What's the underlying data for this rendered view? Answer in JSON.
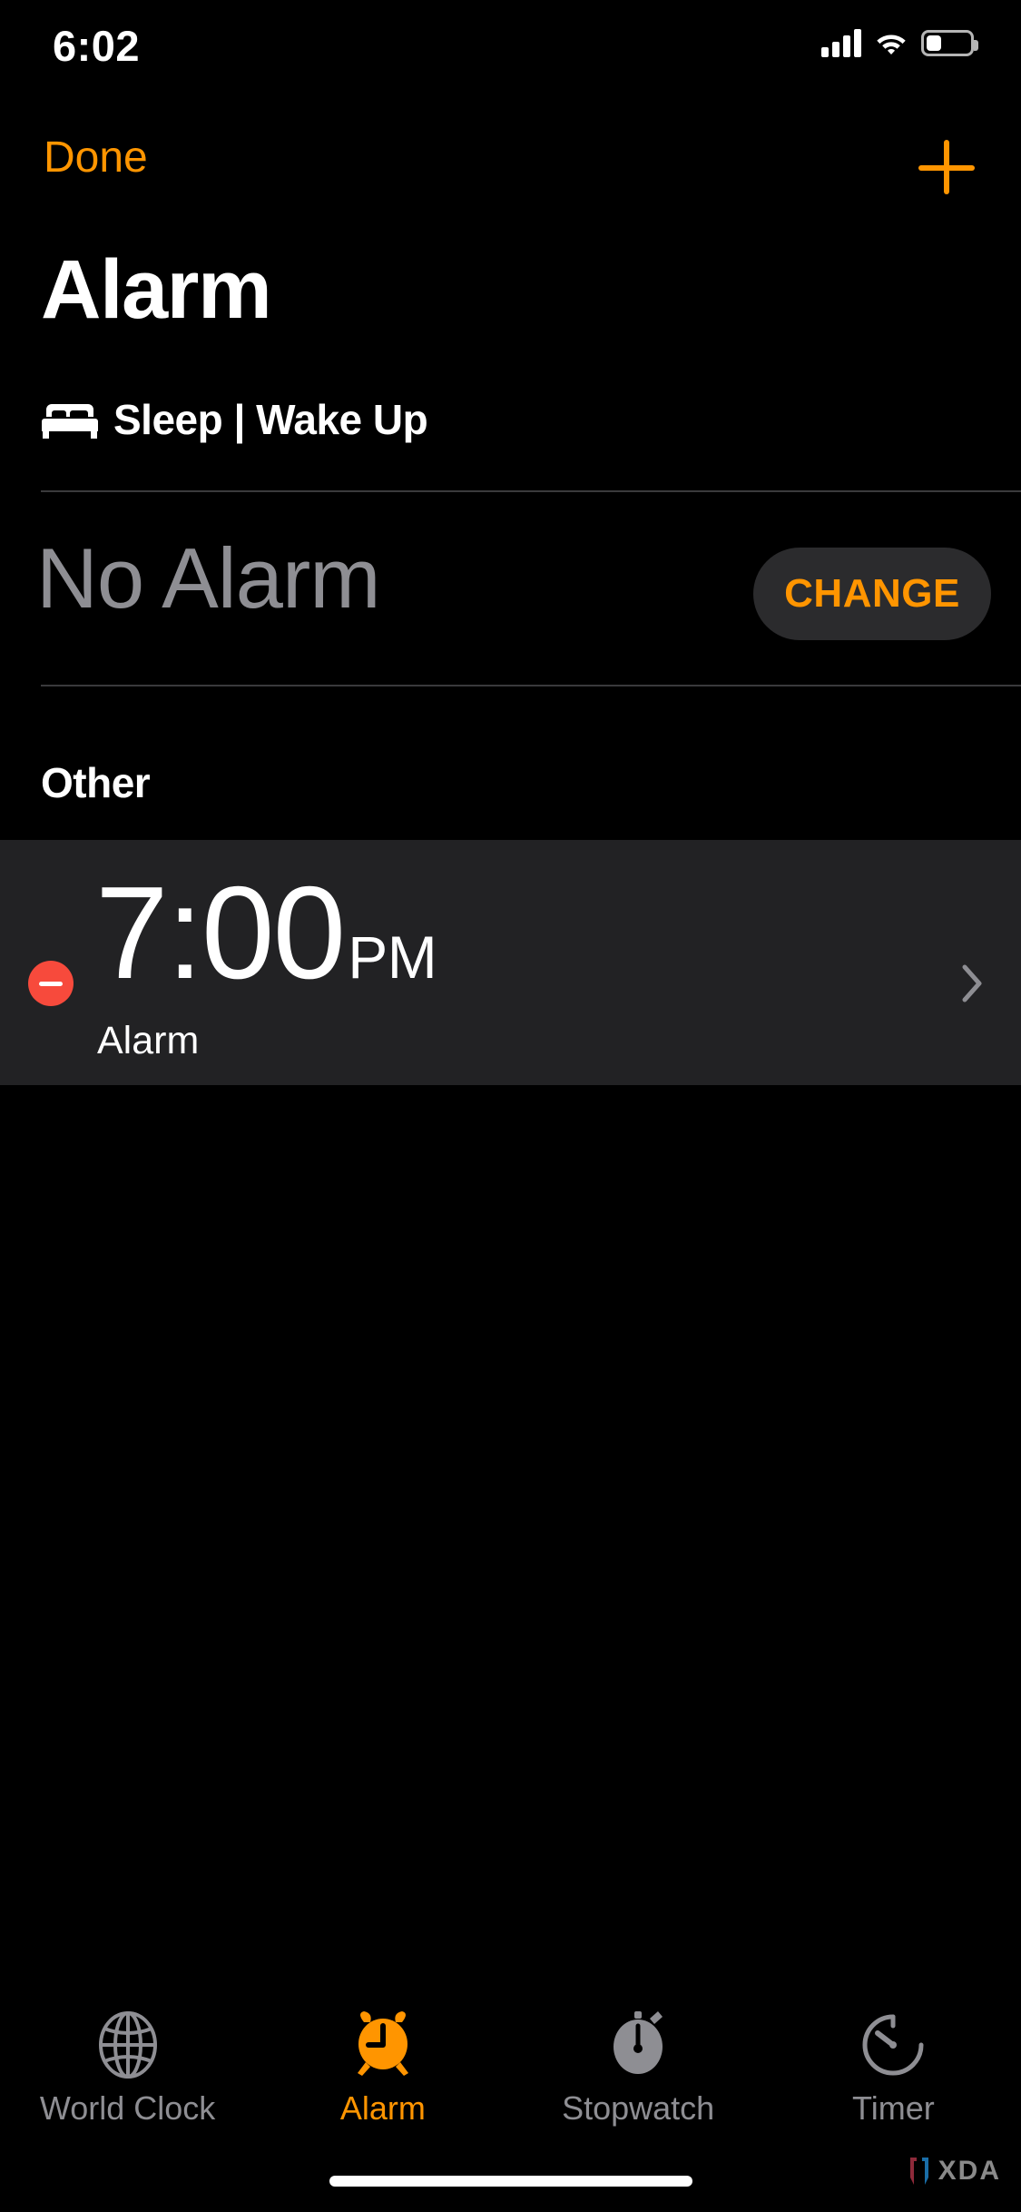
{
  "status_bar": {
    "time": "6:02",
    "signal_icon": "cellular-bars-icon",
    "wifi_icon": "wifi-icon",
    "battery_icon": "battery-icon",
    "battery_level_percent": 35
  },
  "nav": {
    "done_label": "Done",
    "add_icon": "plus-icon"
  },
  "header": {
    "title": "Alarm"
  },
  "sleep_section": {
    "bed_icon": "bed-icon",
    "label": "Sleep | Wake Up",
    "value": "No Alarm",
    "change_label": "CHANGE"
  },
  "other_section": {
    "header": "Other",
    "alarms": [
      {
        "delete_icon": "minus-circle-icon",
        "time": "7:00",
        "meridiem": "PM",
        "label": "Alarm",
        "chevron_icon": "chevron-right-icon"
      }
    ]
  },
  "tabbar": {
    "tabs": [
      {
        "label": "World Clock",
        "icon": "globe-icon",
        "active": false
      },
      {
        "label": "Alarm",
        "icon": "alarm-clock-icon",
        "active": true
      },
      {
        "label": "Stopwatch",
        "icon": "stopwatch-icon",
        "active": false
      },
      {
        "label": "Timer",
        "icon": "timer-icon",
        "active": false
      }
    ]
  },
  "watermark": {
    "text": "XDA"
  },
  "colors": {
    "accent": "#ff9500",
    "destructive": "#f74a3c",
    "background": "#000000",
    "row_background": "#222224",
    "secondary_text": "#8e8e93"
  }
}
